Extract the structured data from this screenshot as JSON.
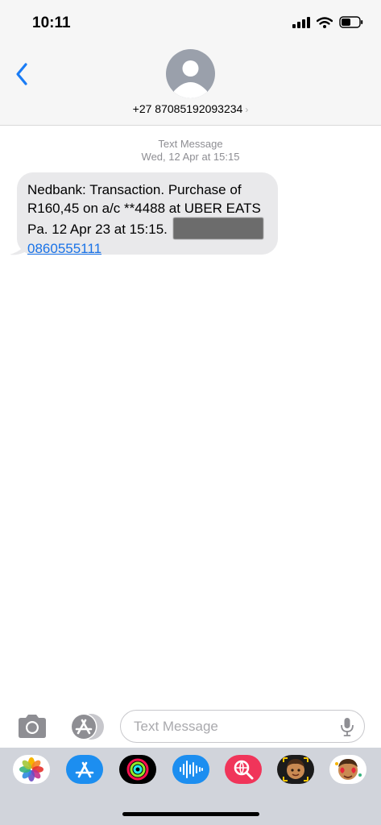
{
  "status_bar": {
    "time": "10:11"
  },
  "header": {
    "contact": "+27 87085192093234",
    "chevron": "›"
  },
  "conversation": {
    "type_label": "Text Message",
    "date_label": "Wed, 12 Apr at 15:15",
    "message": {
      "line1": "Nedbank: Transaction. Purchase of",
      "line2": "R160,45 on a/c **4488 at UBER EATS",
      "line3_start": "Pa. 12 Apr 23 at 15:15.",
      "phone_link": "0860555111"
    }
  },
  "input": {
    "placeholder": "Text Message"
  },
  "drawer": {
    "apps": [
      "photos-icon",
      "app-store-icon",
      "activity-icon",
      "audio-message-icon",
      "images-search-icon",
      "memoji-icon",
      "memoji-stickers-icon"
    ]
  },
  "colors": {
    "link": "#1a73e8",
    "accent": "#1a7cf5",
    "bubble": "#e9e9eb"
  }
}
